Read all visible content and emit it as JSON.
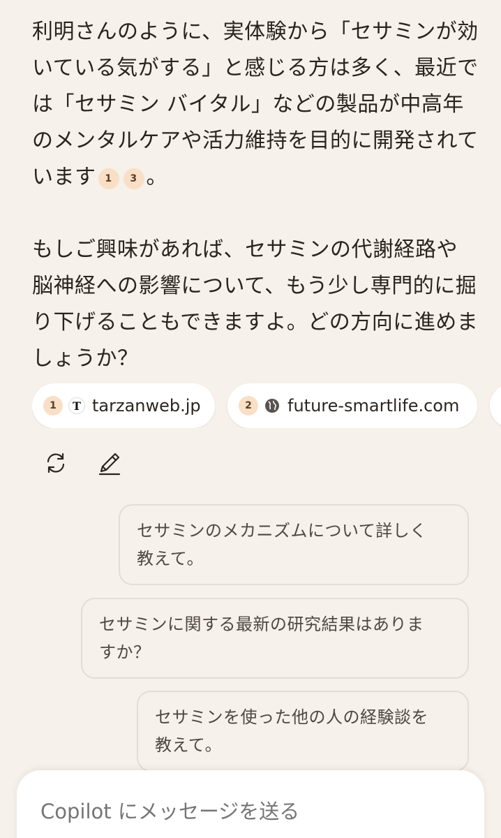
{
  "message": {
    "para1_text": "利明さんのように、実体験から「セサミンが効いている気がする」と感じる方は多く、最近では「セサミン バイタル」などの製品が中高年のメンタルケアや活力維持を目的に開発されています",
    "para1_cites": [
      "1",
      "3"
    ],
    "para1_end": "。",
    "para2_text": "もしご興味があれば、セサミンの代謝経路や脳神経への影響について、もう少し専門的に掘り下げることもできますよ。どの方向に進めましょうか？"
  },
  "sources": [
    {
      "num": "1",
      "favicon": "T",
      "icon": "tarzan-favicon",
      "domain": "tarzanweb.jp"
    },
    {
      "num": "2",
      "icon": "globe-icon",
      "domain": "future-smartlife.com"
    }
  ],
  "actions": {
    "regenerate_icon": "refresh-icon",
    "edit_icon": "edit-pencil-icon"
  },
  "suggestions": [
    {
      "line1": "セサミンのメカニズムについて詳しく",
      "line2": "教えて。"
    },
    {
      "line1": "セサミンに関する最新の研究結果はありま",
      "line2": "すか？"
    },
    {
      "line1": "セサミンを使った他の人の経験談を",
      "line2": "教えて。"
    }
  ],
  "composer": {
    "placeholder": "Copilot にメッセージを送る"
  },
  "colors": {
    "background": "#f6f1ea",
    "citation_badge": "#f9dfc6",
    "chip_background": "#ffffff"
  }
}
